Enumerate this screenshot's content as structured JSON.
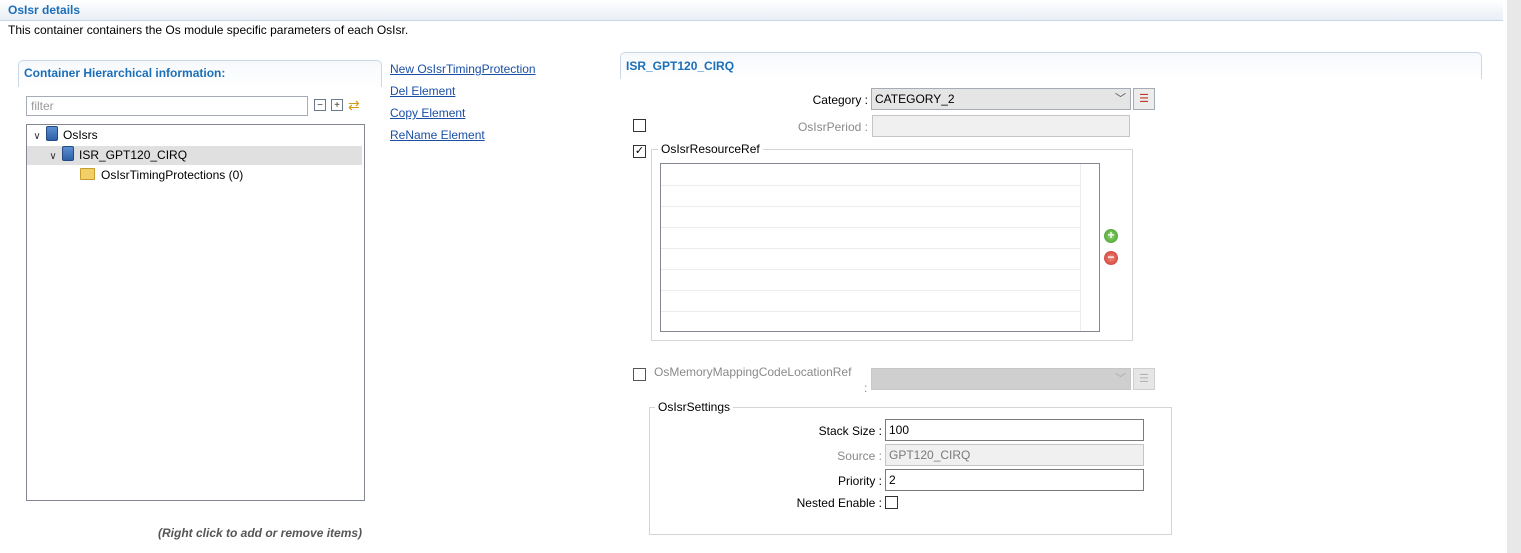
{
  "header": {
    "title": "OsIsr details",
    "description": "This container containers the Os module specific parameters of each OsIsr."
  },
  "left_panel": {
    "title": "Container Hierarchical information:",
    "filter_placeholder": "filter",
    "tree": [
      {
        "label": "OsIsrs",
        "level": 0,
        "expanded": true
      },
      {
        "label": "ISR_GPT120_CIRQ",
        "level": 1,
        "expanded": true,
        "selected": true
      },
      {
        "label": "OsIsrTimingProtections (0)",
        "level": 2
      }
    ],
    "hint": "(Right click to add or remove items)"
  },
  "actions": [
    "New OsIsrTimingProtection",
    "Del Element",
    "Copy Element",
    "ReName Element"
  ],
  "details": {
    "title": "ISR_GPT120_CIRQ",
    "category_label": "Category :",
    "category_value": "CATEGORY_2",
    "period_label": "OsIsrPeriod :",
    "period_checked": false,
    "period_value": "",
    "resource_ref_label": "OsIsrResourceRef",
    "resource_ref_checked": true,
    "memory_mapping_label": "OsMemoryMappingCodeLocationRef",
    "memory_mapping_colon": ":",
    "memory_mapping_checked": false,
    "settings": {
      "title": "OsIsrSettings",
      "stack_size_label": "Stack Size :",
      "stack_size_value": "100",
      "source_label": "Source :",
      "source_value": "GPT120_CIRQ",
      "priority_label": "Priority :",
      "priority_value": "2",
      "nested_enable_label": "Nested Enable :",
      "nested_enable_checked": false
    }
  }
}
